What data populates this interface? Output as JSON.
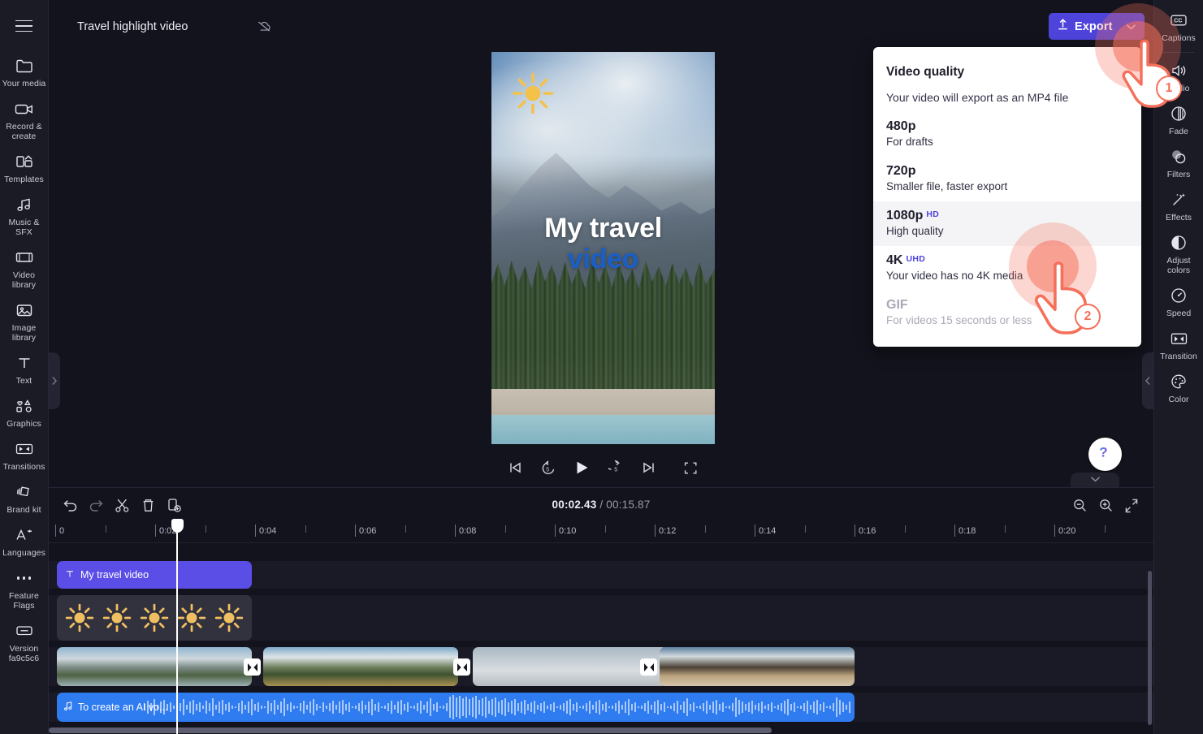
{
  "app": {
    "project_title": "Travel highlight video",
    "cloud_icon": "cloud-off-icon",
    "menu_icon": "hamburger-menu-icon"
  },
  "left_rail": {
    "items": [
      {
        "label": "Your media",
        "icon": "folder-icon"
      },
      {
        "label": "Record & create",
        "icon": "video-camera-icon"
      },
      {
        "label": "Templates",
        "icon": "templates-icon"
      },
      {
        "label": "Music & SFX",
        "icon": "music-note-icon"
      },
      {
        "label": "Video library",
        "icon": "film-strip-icon"
      },
      {
        "label": "Image library",
        "icon": "image-icon"
      },
      {
        "label": "Text",
        "icon": "text-t-icon"
      },
      {
        "label": "Graphics",
        "icon": "shapes-icon"
      },
      {
        "label": "Transitions",
        "icon": "transition-icon"
      },
      {
        "label": "Brand kit",
        "icon": "brand-kit-icon"
      },
      {
        "label": "Languages",
        "icon": "languages-icon"
      },
      {
        "label": "Feature Flags",
        "icon": "ellipsis-icon"
      },
      {
        "label": "Version fa9c5c6",
        "icon": "version-box-icon"
      }
    ]
  },
  "right_rail": {
    "items": [
      {
        "label": "Captions",
        "icon": "closed-captions-icon"
      },
      {
        "label": "Audio",
        "icon": "speaker-volume-icon"
      },
      {
        "label": "Fade",
        "icon": "fade-icon"
      },
      {
        "label": "Filters",
        "icon": "filters-circles-icon"
      },
      {
        "label": "Effects",
        "icon": "magic-wand-icon"
      },
      {
        "label": "Adjust colors",
        "icon": "half-circle-contrast-icon"
      },
      {
        "label": "Speed",
        "icon": "speedometer-icon"
      },
      {
        "label": "Transition",
        "icon": "transition-icon"
      },
      {
        "label": "Color",
        "icon": "palette-icon"
      }
    ]
  },
  "toolbar": {
    "export_label": "Export",
    "export_icon": "upload-arrow-icon",
    "export_chevron": "chevron-down-icon",
    "export_accent": "#4e44db"
  },
  "export_popup": {
    "title": "Video quality",
    "subtitle": "Your video will export as an MP4 file",
    "options": [
      {
        "name": "480p",
        "sup": "",
        "desc": "For drafts",
        "selected": false,
        "disabled": false
      },
      {
        "name": "720p",
        "sup": "",
        "desc": "Smaller file, faster export",
        "selected": false,
        "disabled": false
      },
      {
        "name": "1080p",
        "sup": "HD",
        "desc": "High quality",
        "selected": true,
        "disabled": false
      },
      {
        "name": "4K",
        "sup": "UHD",
        "desc": "Your video has no 4K media",
        "selected": false,
        "disabled": false
      },
      {
        "name": "GIF",
        "sup": "",
        "desc": "For videos 15 seconds or less",
        "selected": false,
        "disabled": true
      }
    ]
  },
  "annotations": [
    {
      "number": "1",
      "target": "export-dropdown-chevron"
    },
    {
      "number": "2",
      "target": "quality-option-1080p"
    }
  ],
  "preview": {
    "title_line1": "My travel",
    "title_line2": "video",
    "title_color_line1": "#ffffff",
    "title_color_line2": "#1a5fc8",
    "sticker": "sun-sticker",
    "controls": [
      {
        "name": "skip-to-start",
        "icon": "skip-back-icon"
      },
      {
        "name": "rewind-5s",
        "icon": "rewind-5-icon"
      },
      {
        "name": "play",
        "icon": "play-icon"
      },
      {
        "name": "forward-5s",
        "icon": "forward-5-icon"
      },
      {
        "name": "skip-to-end",
        "icon": "skip-forward-icon"
      },
      {
        "name": "fullscreen",
        "icon": "fullscreen-icon"
      }
    ],
    "help_icon": "question-mark-icon"
  },
  "timeline": {
    "tools": [
      {
        "name": "undo",
        "icon": "undo-arrow-icon"
      },
      {
        "name": "redo",
        "icon": "redo-arrow-icon"
      },
      {
        "name": "split",
        "icon": "scissors-icon"
      },
      {
        "name": "delete",
        "icon": "trash-icon"
      },
      {
        "name": "duplicate",
        "icon": "duplicate-plus-icon"
      }
    ],
    "current_time": "00:02.43",
    "separator": " / ",
    "total_time": "00:15.87",
    "zoom_controls": [
      {
        "name": "zoom-out",
        "icon": "magnifier-minus-icon"
      },
      {
        "name": "zoom-in",
        "icon": "magnifier-plus-icon"
      },
      {
        "name": "fit-to-timeline",
        "icon": "fit-arrows-icon"
      }
    ],
    "ruler_labels": [
      "0",
      "0:02",
      "0:04",
      "0:06",
      "0:08",
      "0:10",
      "0:12",
      "0:14",
      "0:16",
      "0:18",
      "0:20"
    ],
    "playhead_time": "00:02.43",
    "tracks": [
      {
        "type": "text",
        "label": "My travel video",
        "icon": "text-t-icon"
      },
      {
        "type": "graphics",
        "label": "",
        "icon": "sun-sticker"
      },
      {
        "type": "video",
        "label": "",
        "icon": ""
      },
      {
        "type": "audio",
        "label": "To create an AI vo...",
        "icon": "music-note-icon"
      }
    ]
  }
}
